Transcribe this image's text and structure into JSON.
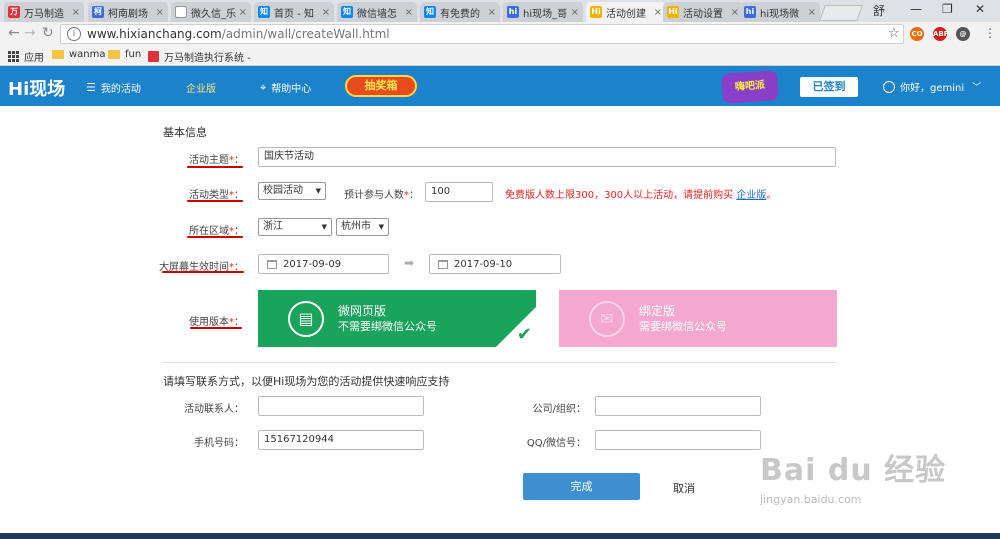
{
  "browser": {
    "tabs": [
      {
        "title": "万马制造",
        "fav_color": "#e0303a",
        "fav": "万",
        "active": false
      },
      {
        "title": "柯南剧场",
        "fav_color": "#3a6fd8",
        "fav": "柯",
        "active": false
      },
      {
        "title": "微久信_乐",
        "fav_color": "#ffffff",
        "fav": "",
        "active": false
      },
      {
        "title": "首页 - 知",
        "fav_color": "#0f88eb",
        "fav": "知",
        "active": false
      },
      {
        "title": "微信墙怎",
        "fav_color": "#0f88eb",
        "fav": "知",
        "active": false
      },
      {
        "title": "有免费的",
        "fav_color": "#0f88eb",
        "fav": "知",
        "active": false
      },
      {
        "title": "hi现场_哥",
        "fav_color": "#3a6fd8",
        "fav": "hi",
        "active": false
      },
      {
        "title": "活动创建",
        "fav_color": "#f0b400",
        "fav": "Hi",
        "active": true
      },
      {
        "title": "活动设置",
        "fav_color": "#f0b400",
        "fav": "Hi",
        "active": false
      },
      {
        "title": "hi现场微",
        "fav_color": "#3a6fd8",
        "fav": "hi",
        "active": false
      }
    ],
    "window_user": "舒",
    "url_host": "www.hixianchang.com",
    "url_path": "/admin/wall/createWall.html",
    "extensions": [
      {
        "name": "extension-orange",
        "color": "#ef6c00",
        "label": "CO"
      },
      {
        "name": "adblock-plus",
        "color": "#d61d1d",
        "label": "ABP"
      },
      {
        "name": "extension-dark",
        "color": "#555555",
        "label": "@"
      }
    ],
    "bookmarks": {
      "apps": "应用",
      "items": [
        "wanma",
        "fun",
        "万马制造执行系统 -"
      ]
    }
  },
  "header": {
    "logo": "Hi现场",
    "nav_activities": "我的活动",
    "nav_enterprise": "企业版",
    "nav_help": "帮助中心",
    "lottery_badge": "抽奖箱",
    "promo_badge": "嗨吧派",
    "signed_in_button": "已签到",
    "greeting": "你好，gemini"
  },
  "form": {
    "section_title": "基本信息",
    "topic_label": "活动主题",
    "topic_value": "国庆节活动",
    "type_label": "活动类型",
    "type_value": "校园活动",
    "participants_label": "预计参与人数",
    "participants_value": "100",
    "limit_note": "免费版人数上限300，300人以上活动，请提前购买",
    "limit_link": "企业版",
    "region_label": "所在区域",
    "province_value": "浙江",
    "city_value": "杭州市",
    "screen_time_label": "大屏幕生效时间",
    "start_date": "2017-09-09",
    "end_date": "2017-09-10",
    "version_label": "使用版本",
    "version_web_title": "微网页版",
    "version_web_desc": "不需要绑微信公众号",
    "version_bind_title": "绑定版",
    "version_bind_desc": "需要绑微信公众号",
    "required_mark": "*",
    "colon": "："
  },
  "contact": {
    "title": "请填写联系方式，以便Hi现场为您的活动提供快速响应支持",
    "contact_person_label": "活动联系人：",
    "contact_person_value": "",
    "company_label": "公司/组织：",
    "company_value": "",
    "phone_label": "手机号码：",
    "phone_value": "15167120944",
    "qq_label": "QQ/微信号：",
    "qq_value": ""
  },
  "actions": {
    "submit": "完成",
    "cancel": "取消"
  },
  "watermark": {
    "brand": "Bai du 经验",
    "url": "jingyan.baidu.com"
  },
  "colors": {
    "header_blue": "#1c82cc",
    "web_version_green": "#1aa35a",
    "bind_version_pink": "#f4a7cf",
    "required_red": "#ee2222"
  }
}
